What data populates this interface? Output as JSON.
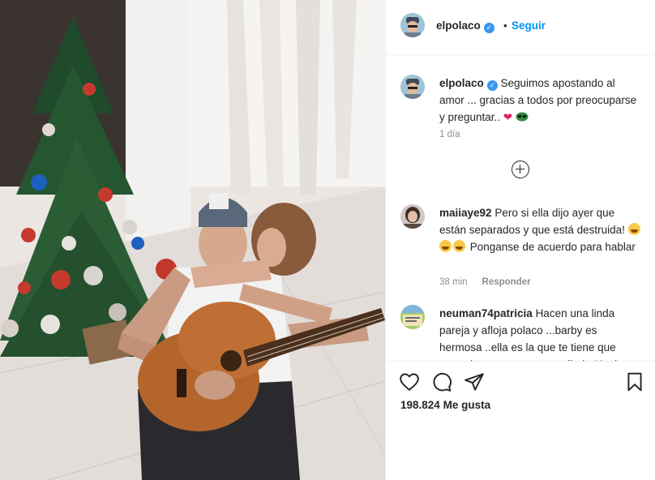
{
  "post": {
    "username": "elpolaco",
    "verified_mark": "✓",
    "follow_label": "Seguir",
    "separator": "•"
  },
  "caption": {
    "username": "elpolaco",
    "text": "Seguimos apostando al amor ... gracias a todos por preocuparse y preguntar..",
    "emoji_tail": "❤",
    "time": "1 día"
  },
  "comments": [
    {
      "username": "maiiaye92",
      "text_a": "Pero si ella dijo ayer que están separados y que está destruida!",
      "text_b": "Ponganse de acuerdo para hablar",
      "time": "38 min",
      "reply_label": "Responder"
    },
    {
      "username": "neuman74patricia",
      "text": "Hacen una linda pareja y afloja polaco ...barby es hermosa ..ella es la que te tiene que meter las cuernos es muy linda Mucho"
    }
  ],
  "likes": {
    "count": "198.824",
    "label": "Me gusta"
  },
  "icons": {
    "like": "heart-outline-icon",
    "comment": "comment-bubble-icon",
    "share": "paper-plane-icon",
    "save": "bookmark-icon",
    "more": "plus-circle-icon"
  },
  "colors": {
    "link": "#0095f6",
    "verified": "#3897f0",
    "text": "#262626",
    "muted": "#8e8e8e"
  }
}
